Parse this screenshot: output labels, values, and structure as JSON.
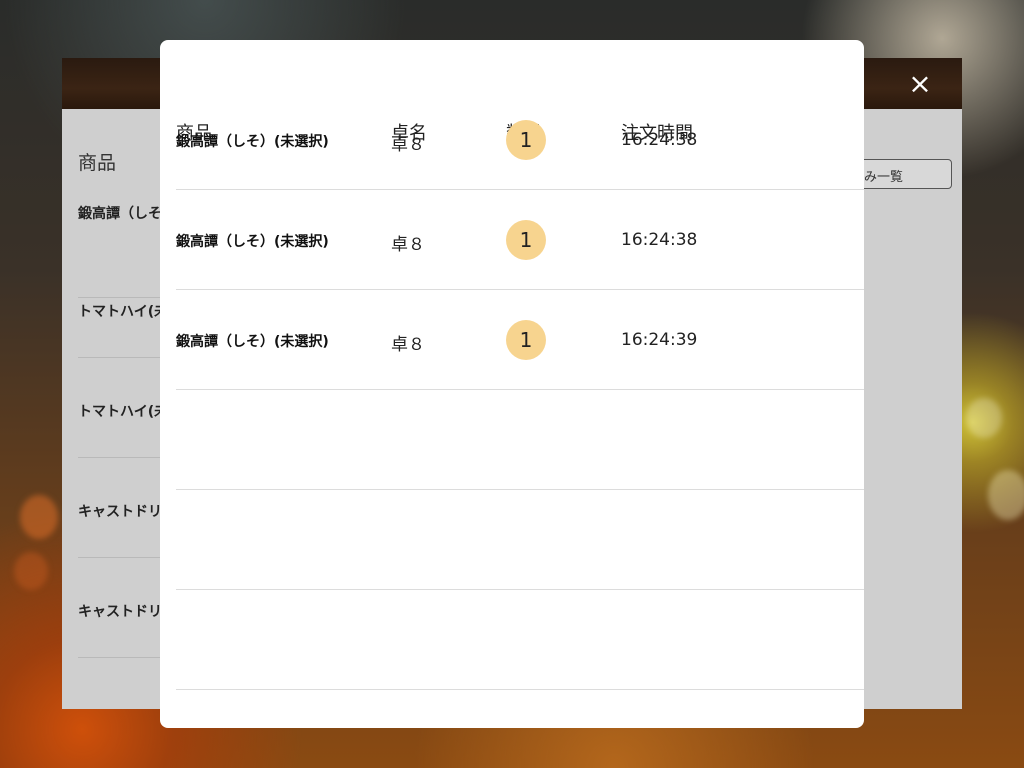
{
  "back_panel": {
    "column_title": "商品",
    "items": [
      "鍛高譚（しそ",
      "トマトハイ(未",
      "トマトハイ(未",
      "キャストドリ",
      "キャストドリ"
    ],
    "list_button_label": "済み一覧",
    "close_icon": "×"
  },
  "modal": {
    "headers": {
      "product": "商品",
      "table": "卓名",
      "quantity": "数量",
      "order_time": "注文時間"
    },
    "rows": [
      {
        "product": "鍛高譚（しそ）(未選択)",
        "table": "卓８",
        "quantity": "1",
        "time": "16:24:38"
      },
      {
        "product": "鍛高譚（しそ）(未選択)",
        "table": "卓８",
        "quantity": "1",
        "time": "16:24:38"
      },
      {
        "product": "鍛高譚（しそ）(未選択)",
        "table": "卓８",
        "quantity": "1",
        "time": "16:24:39"
      }
    ]
  },
  "colors": {
    "quantity_badge": "#f7d48f",
    "header_bar": "#3b2414",
    "panel_gray": "#cfcfcf"
  }
}
